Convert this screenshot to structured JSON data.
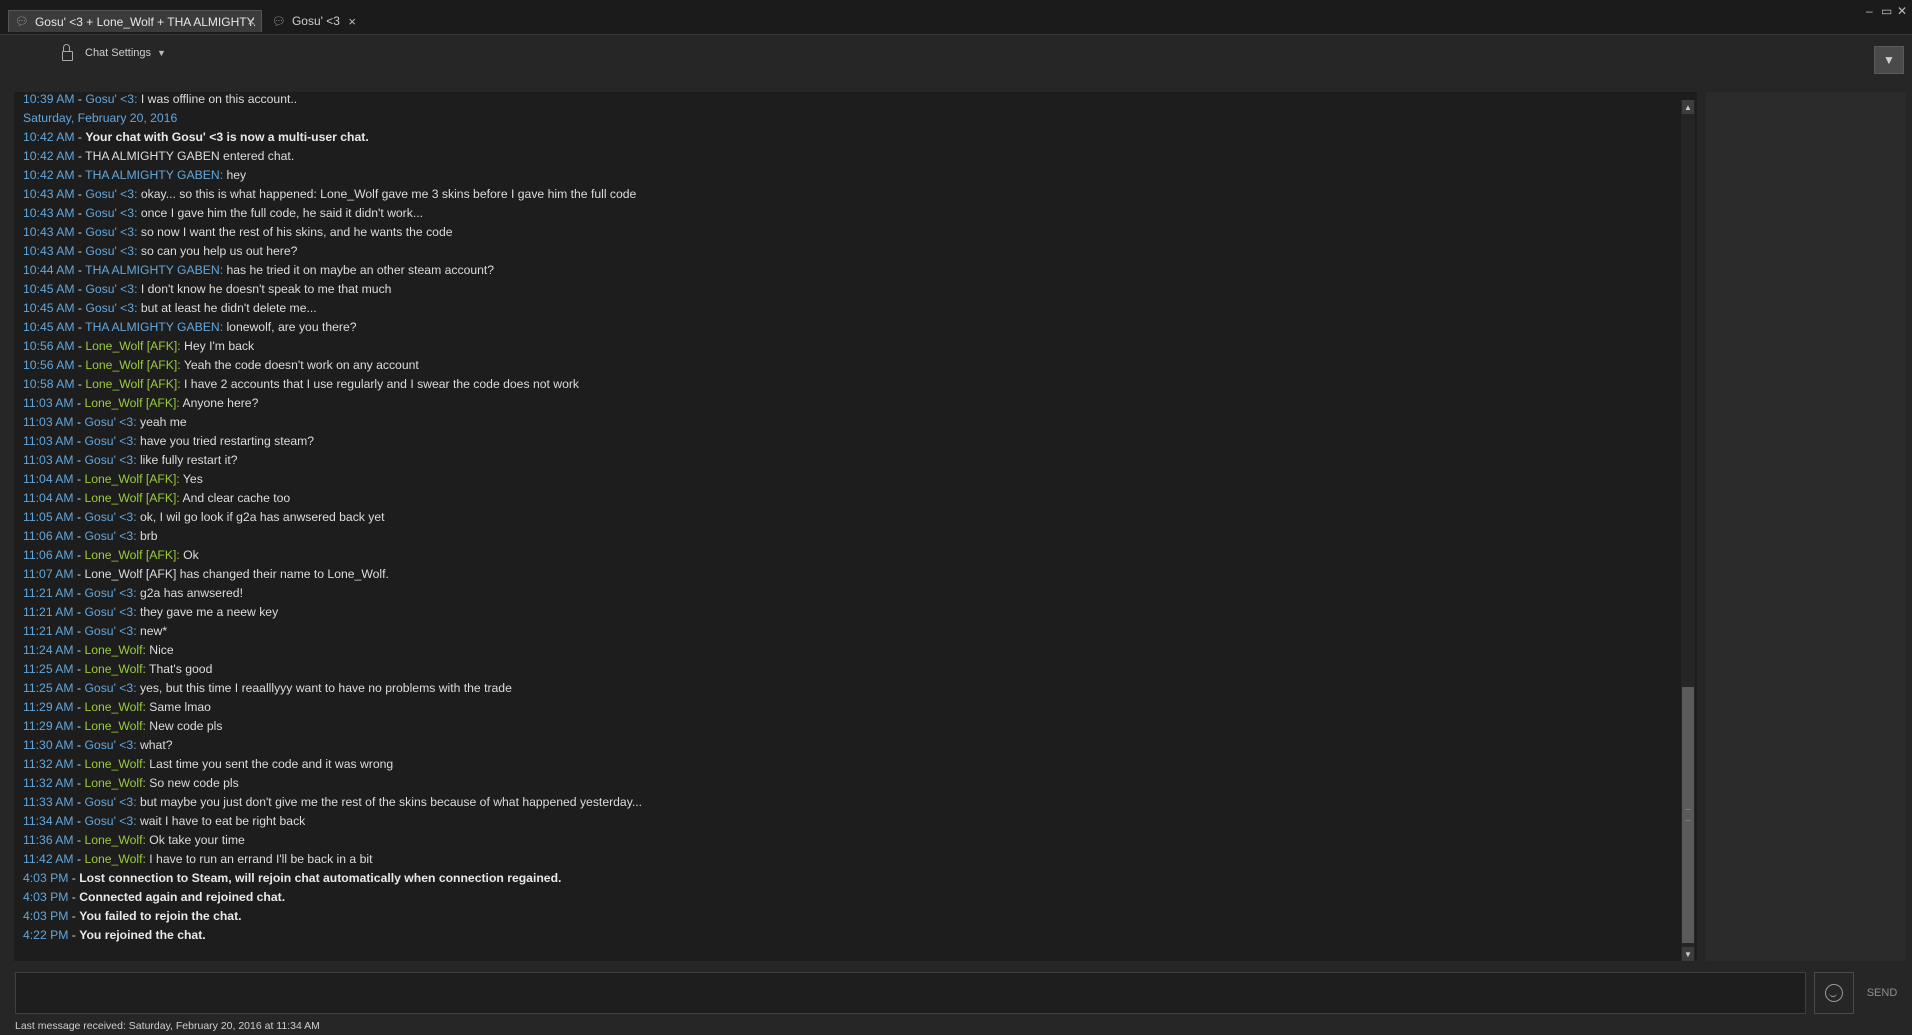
{
  "tabs": [
    {
      "label": "Gosu' <3 + Lone_Wolf + THA ALMIGHTY...",
      "close": "×",
      "active": true
    },
    {
      "label": "Gosu' <3",
      "close": "×",
      "active": false
    }
  ],
  "window_controls": {
    "minimize": "–",
    "maximize": "▭",
    "close": "✕"
  },
  "settings": {
    "label": "Chat Settings",
    "caret": "▼"
  },
  "dropdown_caret": "▼",
  "chat": [
    {
      "time": "10:39 AM",
      "name": "Gosu' <3",
      "cls": "name-gosu",
      "text": "I was offline on this account.."
    },
    {
      "date": "Saturday, February 20, 2016"
    },
    {
      "time": "10:42 AM",
      "sys": "Your chat with Gosu' <3 is now a multi-user chat.",
      "bold": true
    },
    {
      "time": "10:42 AM",
      "sys": "THA ALMIGHTY GABEN entered chat."
    },
    {
      "time": "10:42 AM",
      "name": "THA ALMIGHTY GABEN",
      "cls": "name-gaben",
      "text": "hey"
    },
    {
      "time": "10:43 AM",
      "name": "Gosu' <3",
      "cls": "name-gosu",
      "text": "okay... so this is what happened: Lone_Wolf gave me 3 skins before I gave him the full code"
    },
    {
      "time": "10:43 AM",
      "name": "Gosu' <3",
      "cls": "name-gosu",
      "text": "once I gave him the full code, he said it didn't work..."
    },
    {
      "time": "10:43 AM",
      "name": "Gosu' <3",
      "cls": "name-gosu",
      "text": "so now I want the rest of his skins, and he wants the code"
    },
    {
      "time": "10:43 AM",
      "name": "Gosu' <3",
      "cls": "name-gosu",
      "text": "so can you help us out here?"
    },
    {
      "time": "10:44 AM",
      "name": "THA ALMIGHTY GABEN",
      "cls": "name-gaben",
      "text": "has he tried it on maybe an other steam account?"
    },
    {
      "time": "10:45 AM",
      "name": "Gosu' <3",
      "cls": "name-gosu",
      "text": "I don't know he doesn't speak to me that much"
    },
    {
      "time": "10:45 AM",
      "name": "Gosu' <3",
      "cls": "name-gosu",
      "text": "but at least he didn't delete me..."
    },
    {
      "time": "10:45 AM",
      "name": "THA ALMIGHTY GABEN",
      "cls": "name-gaben",
      "text": "lonewolf, are you there?"
    },
    {
      "time": "10:56 AM",
      "name": "Lone_Wolf [AFK]",
      "cls": "name-wolf",
      "text": "Hey I'm back"
    },
    {
      "time": "10:56 AM",
      "name": "Lone_Wolf [AFK]",
      "cls": "name-wolf",
      "text": "Yeah the code doesn't work on any account"
    },
    {
      "time": "10:58 AM",
      "name": "Lone_Wolf [AFK]",
      "cls": "name-wolf",
      "text": "I have 2 accounts that I use regularly and I swear the code does not work"
    },
    {
      "time": "11:03 AM",
      "name": "Lone_Wolf [AFK]",
      "cls": "name-wolf",
      "text": "Anyone here?"
    },
    {
      "time": "11:03 AM",
      "name": "Gosu' <3",
      "cls": "name-gosu",
      "text": "yeah me"
    },
    {
      "time": "11:03 AM",
      "name": "Gosu' <3",
      "cls": "name-gosu",
      "text": "have you tried restarting steam?"
    },
    {
      "time": "11:03 AM",
      "name": "Gosu' <3",
      "cls": "name-gosu",
      "text": "like fully restart it?"
    },
    {
      "time": "11:04 AM",
      "name": "Lone_Wolf [AFK]",
      "cls": "name-wolf",
      "text": "Yes"
    },
    {
      "time": "11:04 AM",
      "name": "Lone_Wolf [AFK]",
      "cls": "name-wolf",
      "text": "And clear cache too"
    },
    {
      "time": "11:05 AM",
      "name": "Gosu' <3",
      "cls": "name-gosu",
      "text": "ok, I wil go look if g2a has anwsered back yet"
    },
    {
      "time": "11:06 AM",
      "name": "Gosu' <3",
      "cls": "name-gosu",
      "text": "brb"
    },
    {
      "time": "11:06 AM",
      "name": "Lone_Wolf [AFK]",
      "cls": "name-wolf",
      "text": "Ok"
    },
    {
      "time": "11:07 AM",
      "sys": "Lone_Wolf [AFK] has changed their name to Lone_Wolf."
    },
    {
      "time": "11:21 AM",
      "name": "Gosu' <3",
      "cls": "name-gosu",
      "text": "g2a has anwsered!"
    },
    {
      "time": "11:21 AM",
      "name": "Gosu' <3",
      "cls": "name-gosu",
      "text": "they gave me a neew key"
    },
    {
      "time": "11:21 AM",
      "name": "Gosu' <3",
      "cls": "name-gosu",
      "text": "new*"
    },
    {
      "time": "11:24 AM",
      "name": "Lone_Wolf",
      "cls": "name-wolf",
      "text": "Nice"
    },
    {
      "time": "11:25 AM",
      "name": "Lone_Wolf",
      "cls": "name-wolf",
      "text": "That's good"
    },
    {
      "time": "11:25 AM",
      "name": "Gosu' <3",
      "cls": "name-gosu",
      "text": "yes, but this time I reaalllyyy want to have no problems with the trade"
    },
    {
      "time": "11:29 AM",
      "name": "Lone_Wolf",
      "cls": "name-wolf",
      "text": "Same lmao"
    },
    {
      "time": "11:29 AM",
      "name": "Lone_Wolf",
      "cls": "name-wolf",
      "text": "New code pls"
    },
    {
      "time": "11:30 AM",
      "name": "Gosu' <3",
      "cls": "name-gosu",
      "text": "what?"
    },
    {
      "time": "11:32 AM",
      "name": "Lone_Wolf",
      "cls": "name-wolf",
      "text": "Last time you sent the code and it was wrong"
    },
    {
      "time": "11:32 AM",
      "name": "Lone_Wolf",
      "cls": "name-wolf",
      "text": "So new code pls"
    },
    {
      "time": "11:33 AM",
      "name": "Gosu' <3",
      "cls": "name-gosu",
      "text": "but maybe you just don't give me the rest of the skins because of what happened yesterday..."
    },
    {
      "time": "11:34 AM",
      "name": "Gosu' <3",
      "cls": "name-gosu",
      "text": "wait I have to eat be right back"
    },
    {
      "time": "11:36 AM",
      "name": "Lone_Wolf",
      "cls": "name-wolf",
      "text": "Ok take your time"
    },
    {
      "time": "11:42 AM",
      "name": "Lone_Wolf",
      "cls": "name-wolf",
      "text": "I have to run an errand I'll be back in a bit"
    },
    {
      "time": "4:03 PM",
      "sys": "Lost connection to Steam, will rejoin chat automatically when connection regained.",
      "bold": true
    },
    {
      "time": "4:03 PM",
      "sys": "Connected again and rejoined chat.",
      "bold": true
    },
    {
      "time": "4:03 PM",
      "sys": "You failed to rejoin the chat.",
      "bold": true
    },
    {
      "time": "4:22 PM",
      "sys": "You rejoined the chat.",
      "bold": true
    }
  ],
  "scroll": {
    "up": "▲",
    "down": "▼"
  },
  "input": {
    "value": "",
    "placeholder": ""
  },
  "send_label": "SEND",
  "status": "Last message received: Saturday, February 20, 2016 at 11:34 AM"
}
